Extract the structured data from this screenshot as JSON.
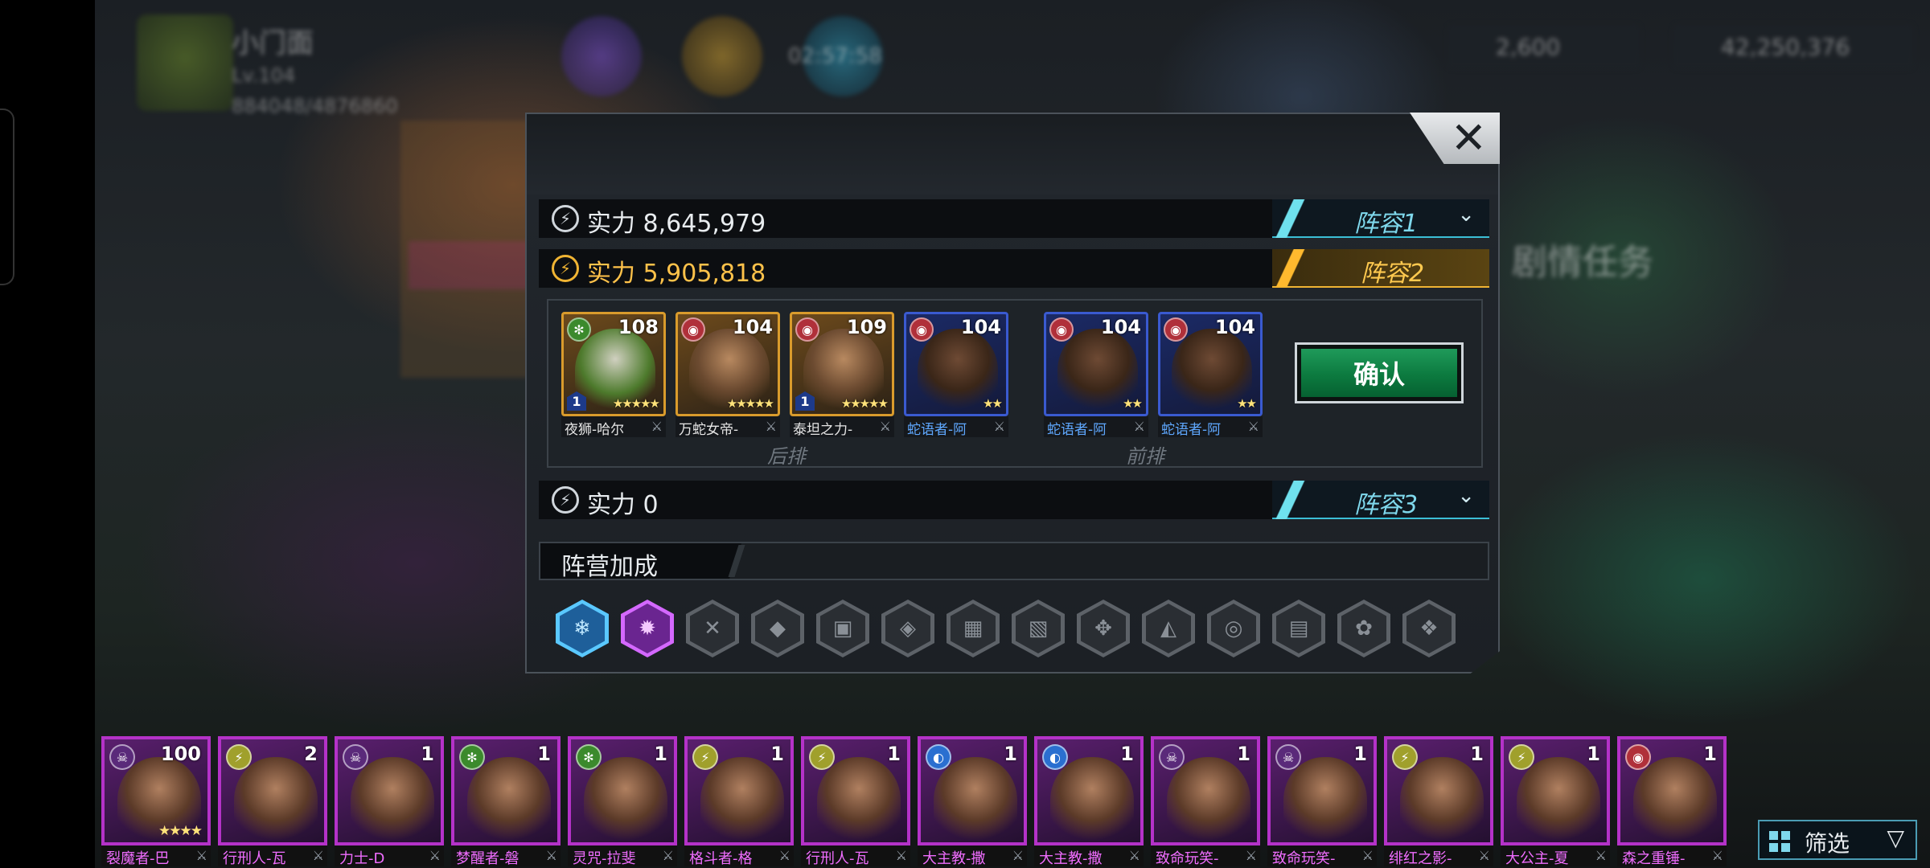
{
  "background": {
    "player_name": "小门面",
    "player_level": "Lv.104",
    "player_exp": "884048/4876860",
    "timer": "02:57:58",
    "resource_gems": "2,600",
    "resource_gold": "42,250,376",
    "banner_text": "剧情任务"
  },
  "modal": {
    "close_label": "✕",
    "teams": [
      {
        "power_label": "实力 8,645,979",
        "tab_label": "阵容1",
        "expanded": false
      },
      {
        "power_label": "实力 5,905,818",
        "tab_label": "阵容2",
        "expanded": true
      },
      {
        "power_label": "实力 0",
        "tab_label": "阵容3",
        "expanded": false
      }
    ],
    "formation": {
      "back_row_label": "后排",
      "front_row_label": "前排",
      "confirm_label": "确认",
      "back_row": [
        {
          "name": "夜狮-哈尔",
          "level": "108",
          "stars": "★★★★★",
          "badge": "1",
          "faction": "nature",
          "rarity": "gold"
        },
        {
          "name": "万蛇女帝-",
          "level": "104",
          "stars": "★★★★★",
          "badge": "",
          "faction": "chaos",
          "rarity": "gold"
        },
        {
          "name": "泰坦之力-",
          "level": "109",
          "stars": "★★★★★",
          "badge": "1",
          "faction": "chaos",
          "rarity": "gold"
        },
        {
          "name": "蛇语者-阿",
          "level": "104",
          "stars": "★★",
          "badge": "",
          "faction": "chaos",
          "rarity": "blue"
        }
      ],
      "front_row": [
        {
          "name": "蛇语者-阿",
          "level": "104",
          "stars": "★★",
          "badge": "",
          "faction": "chaos",
          "rarity": "blue"
        },
        {
          "name": "蛇语者-阿",
          "level": "104",
          "stars": "★★",
          "badge": "",
          "faction": "chaos",
          "rarity": "blue"
        }
      ]
    },
    "faction_bonus_label": "阵营加成"
  },
  "roster": [
    {
      "name": "裂魔者-巴",
      "level": "100",
      "stars": "★★★★",
      "faction": "dark"
    },
    {
      "name": "行刑人-瓦",
      "level": "2",
      "stars": "",
      "faction": "order"
    },
    {
      "name": "力士-D",
      "level": "1",
      "stars": "",
      "faction": "dark"
    },
    {
      "name": "梦醒者-磐",
      "level": "1",
      "stars": "",
      "faction": "nature"
    },
    {
      "name": "灵咒-拉斐",
      "level": "1",
      "stars": "",
      "faction": "nature"
    },
    {
      "name": "格斗者-格",
      "level": "1",
      "stars": "",
      "faction": "order"
    },
    {
      "name": "行刑人-瓦",
      "level": "1",
      "stars": "",
      "faction": "order"
    },
    {
      "name": "大主教-撒",
      "level": "1",
      "stars": "",
      "faction": "tech"
    },
    {
      "name": "大主教-撒",
      "level": "1",
      "stars": "",
      "faction": "tech"
    },
    {
      "name": "致命玩笑-",
      "level": "1",
      "stars": "",
      "faction": "dark"
    },
    {
      "name": "致命玩笑-",
      "level": "1",
      "stars": "",
      "faction": "dark"
    },
    {
      "name": "绯红之影-",
      "level": "1",
      "stars": "",
      "faction": "order"
    },
    {
      "name": "大公主-夏",
      "level": "1",
      "stars": "",
      "faction": "order"
    },
    {
      "name": "森之重锤-",
      "level": "1",
      "stars": "",
      "faction": "chaos"
    }
  ],
  "filter_label": "筛选",
  "colors": {
    "accent_gold": "#f0b433",
    "accent_cyan": "#6fe1ee",
    "confirm_green": "#0c7a3f",
    "epic_purple": "#b432c8"
  }
}
